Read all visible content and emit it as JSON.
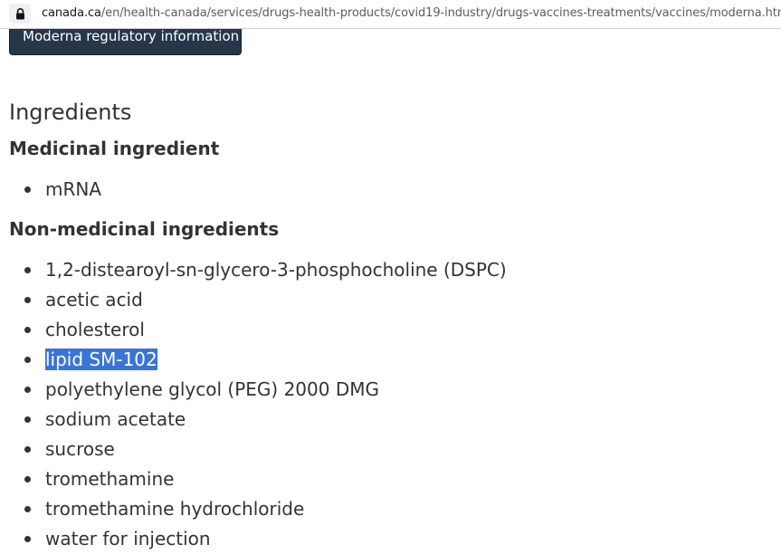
{
  "browser": {
    "url_domain": "canada.ca",
    "url_path": "/en/health-canada/services/drugs-health-products/covid19-industry/drugs-vaccines-treatments/vaccines/moderna.html",
    "lock_icon": "lock-icon"
  },
  "page": {
    "regulatory_button_label": "Moderna regulatory information",
    "section_title": "Ingredients",
    "medicinal_heading": "Medicinal ingredient",
    "medicinal_items": [
      "mRNA"
    ],
    "non_medicinal_heading": "Non-medicinal ingredients",
    "non_medicinal_items": [
      "1,2-distearoyl-sn-glycero-3-phosphocholine (DSPC)",
      "acetic acid",
      "cholesterol",
      "lipid SM-102",
      "polyethylene glycol (PEG) 2000 DMG",
      "sodium acetate",
      "sucrose",
      "tromethamine",
      "tromethamine hydrochloride",
      "water for injection"
    ],
    "selected_item": "lipid SM-102"
  },
  "colors": {
    "button_bg": "#26374a",
    "selection_bg": "#3875d7",
    "text": "#333333"
  }
}
